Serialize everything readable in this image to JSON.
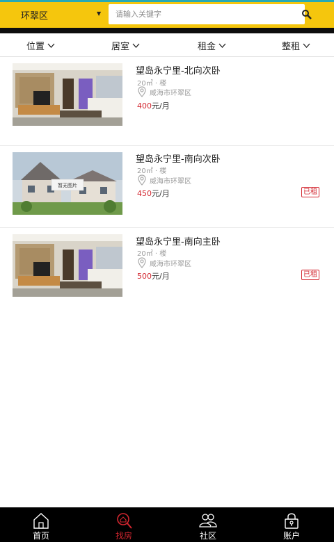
{
  "header": {
    "city": "环翠区",
    "search_placeholder": "请输入关键字"
  },
  "filters": [
    {
      "label": "位置"
    },
    {
      "label": "居室"
    },
    {
      "label": "租金"
    },
    {
      "label": "整租"
    }
  ],
  "listings": [
    {
      "title": "望岛永宁里-北向次卧",
      "spec": "20㎡ · 楼",
      "location": "威海市环翠区",
      "price": "400",
      "price_unit": "元/月",
      "badge": "",
      "image": "living-room-photo"
    },
    {
      "title": "望岛永宁里-南向次卧",
      "spec": "20㎡ · 楼",
      "location": "威海市环翠区",
      "price": "450",
      "price_unit": "元/月",
      "badge": "已租",
      "image": "placeholder-house-photo",
      "image_caption": "暂无图片"
    },
    {
      "title": "望岛永宁里-南向主卧",
      "spec": "20㎡ · 楼",
      "location": "威海市环翠区",
      "price": "500",
      "price_unit": "元/月",
      "badge": "已租",
      "image": "living-room-photo"
    }
  ],
  "bottom_nav": [
    {
      "label": "首页",
      "icon": "home-icon"
    },
    {
      "label": "找房",
      "icon": "search-house-icon",
      "active": true
    },
    {
      "label": "社区",
      "icon": "community-icon"
    },
    {
      "label": "账户",
      "icon": "account-lock-icon"
    }
  ],
  "colors": {
    "topbar": "#f5c60d",
    "accent": "#d3262f",
    "nav_bg": "#000000"
  }
}
